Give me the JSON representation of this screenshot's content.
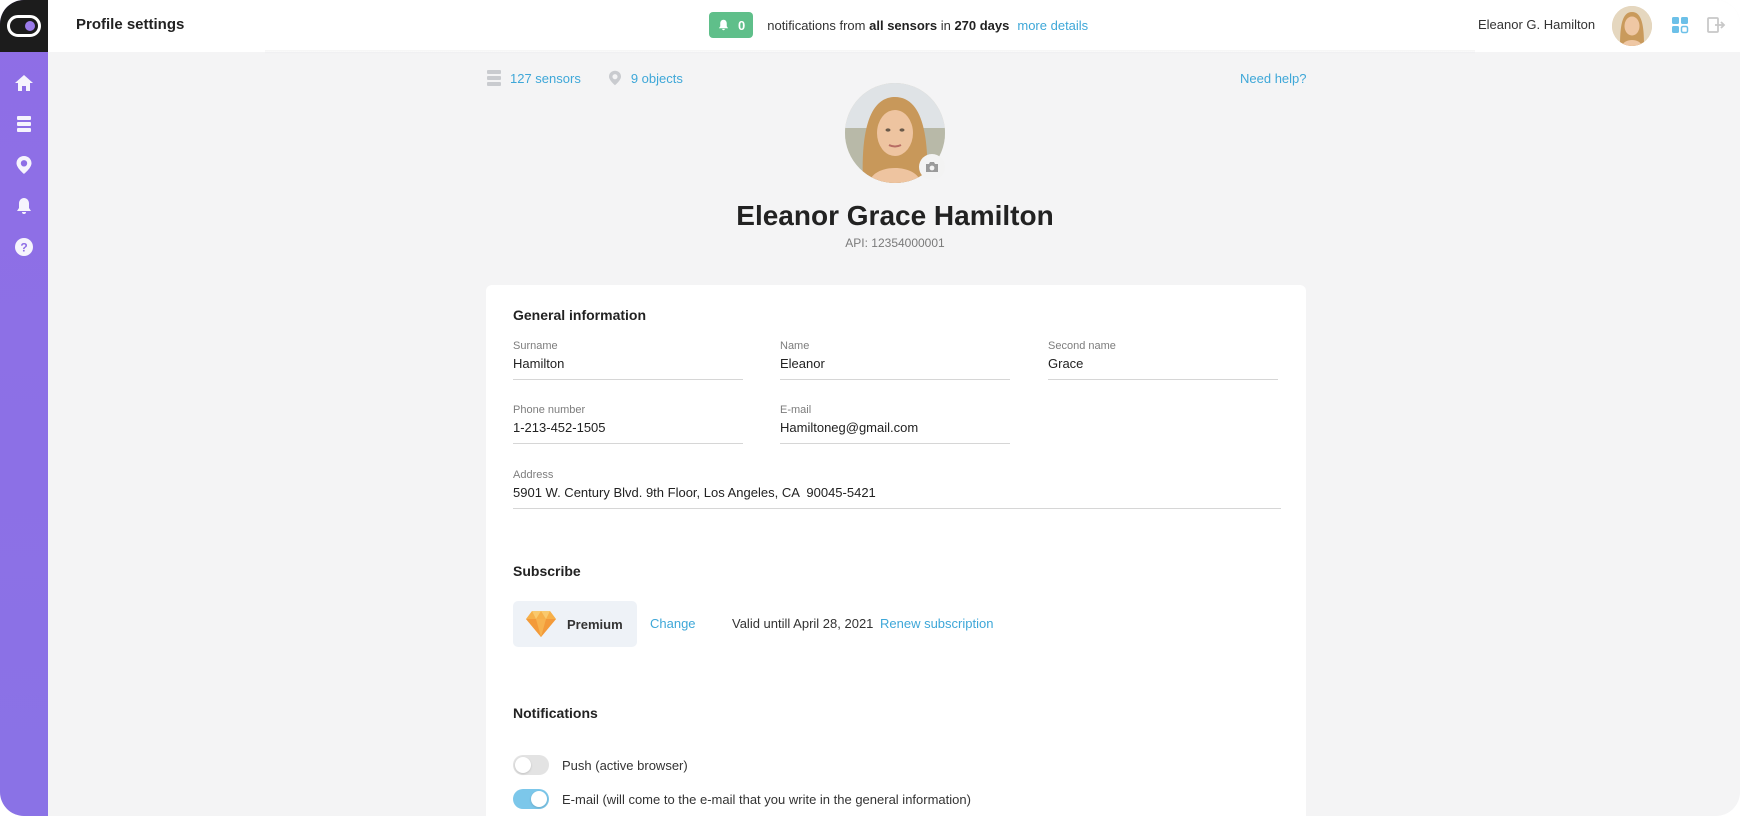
{
  "header": {
    "title": "Profile settings",
    "notifications": {
      "count": "0",
      "text_prefix": "notifications from",
      "text_bold_sensors": "all sensors",
      "text_in": "in",
      "text_bold_days": "270 days",
      "link": "more details"
    },
    "user_name": "Eleanor G. Hamilton"
  },
  "sidebar": {
    "items": [
      {
        "icon": "home-icon"
      },
      {
        "icon": "sensors-icon"
      },
      {
        "icon": "location-pin-icon"
      },
      {
        "icon": "bell-icon"
      },
      {
        "icon": "help-icon"
      }
    ]
  },
  "stats": {
    "sensors": "127 sensors",
    "objects": "9 objects",
    "need_help": "Need help?"
  },
  "profile": {
    "full_name": "Eleanor Grace Hamilton",
    "api": "API: 12354000001"
  },
  "general": {
    "title": "General information",
    "surname_label": "Surname",
    "surname": "Hamilton",
    "name_label": "Name",
    "name": "Eleanor",
    "second_name_label": "Second name",
    "second_name": "Grace",
    "phone_label": "Phone number",
    "phone": "1-213-452-1505",
    "email_label": "E-mail",
    "email": "Hamiltoneg@gmail.com",
    "address_label": "Address",
    "address": "5901 W. Century Blvd. 9th Floor, Los Angeles, CA  90045-5421"
  },
  "subscribe": {
    "title": "Subscribe",
    "plan": "Premium",
    "change": "Change",
    "valid": "Valid untill April 28, 2021",
    "renew": "Renew subscription"
  },
  "notifications": {
    "title": "Notifications",
    "push_label": "Push (active browser)",
    "push_enabled": false,
    "email_label": "E-mail (will come to the e-mail that you write in the general information)",
    "email_enabled": true
  },
  "colors": {
    "sidebar": "#8f6ee6",
    "accent_link": "#3ea7d8",
    "badge_green": "#5fbf8a",
    "toggle_on": "#7cc7ea"
  }
}
